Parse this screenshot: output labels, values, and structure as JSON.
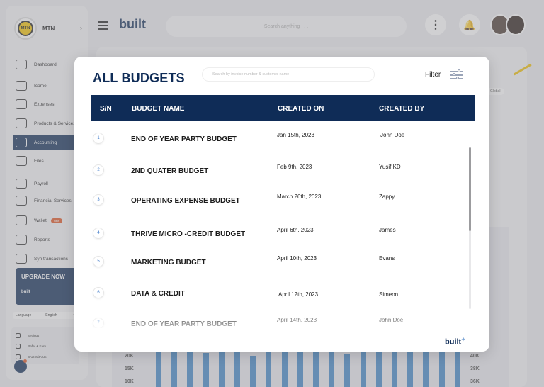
{
  "sidebar": {
    "company": "MTN",
    "logo_text": "MTN",
    "items": [
      {
        "label": "Dashboard",
        "icon": "grid-icon"
      },
      {
        "label": "Icome",
        "icon": "income-icon"
      },
      {
        "label": "Expenses",
        "icon": "expenses-icon"
      },
      {
        "label": "Products & Services",
        "icon": "products-icon"
      },
      {
        "label": "Accounting",
        "icon": "scale-icon",
        "active": true
      },
      {
        "label": "Files",
        "icon": "folder-icon"
      },
      {
        "label": "Payroll",
        "icon": "payroll-icon"
      },
      {
        "label": "Financial Services",
        "icon": "bank-icon"
      },
      {
        "label": "Wallet",
        "icon": "wallet-icon",
        "badge": "New"
      },
      {
        "label": "Reports",
        "icon": "report-icon"
      },
      {
        "label": "Syn transactions",
        "icon": "cloud-icon"
      }
    ],
    "upgrade": {
      "title": "UPGRADE NOW",
      "brand": "built"
    },
    "language": {
      "label": "Language",
      "value": "English"
    },
    "bottom_menu": [
      "Settings",
      "Refer & Earn",
      "Chat With Us"
    ]
  },
  "topbar": {
    "brand": "built",
    "search_placeholder": "Search anything . . ."
  },
  "background": {
    "chip": "Global",
    "y_left": [
      "20K",
      "15K",
      "10K"
    ],
    "y_right": [
      "40K",
      "38K",
      "36K"
    ]
  },
  "modal": {
    "title": "ALL BUDGETS",
    "search_placeholder": "Search by invoice number & customer name",
    "filter_label": "Filter",
    "brand": "built",
    "columns": [
      "S/N",
      "BUDGET NAME",
      "CREATED ON",
      "CREATED BY"
    ],
    "rows": [
      {
        "sn": "1",
        "name": "END OF YEAR PARTY BUDGET",
        "created_on": "Jan 15th, 2023",
        "created_by": "John Doe"
      },
      {
        "sn": "2",
        "name": "2ND QUATER BUDGET",
        "created_on": "Feb 9th, 2023",
        "created_by": "Yusif KD"
      },
      {
        "sn": "3",
        "name": "OPERATING EXPENSE BUDGET",
        "created_on": "March 26th, 2023",
        "created_by": "Zappy"
      },
      {
        "sn": "4",
        "name": "THRIVE MICRO -CREDIT BUDGET",
        "created_on": "April 6th, 2023",
        "created_by": "James"
      },
      {
        "sn": "5",
        "name": "MARKETING BUDGET",
        "created_on": "April 10th, 2023",
        "created_by": "Evans"
      },
      {
        "sn": "6",
        "name": "DATA & CREDIT",
        "created_on": "April 12th, 2023",
        "created_by": "Simeon"
      },
      {
        "sn": "7",
        "name": "END OF YEAR PARTY BUDGET",
        "created_on": "April 14th, 2023",
        "created_by": "John Doe"
      }
    ]
  }
}
